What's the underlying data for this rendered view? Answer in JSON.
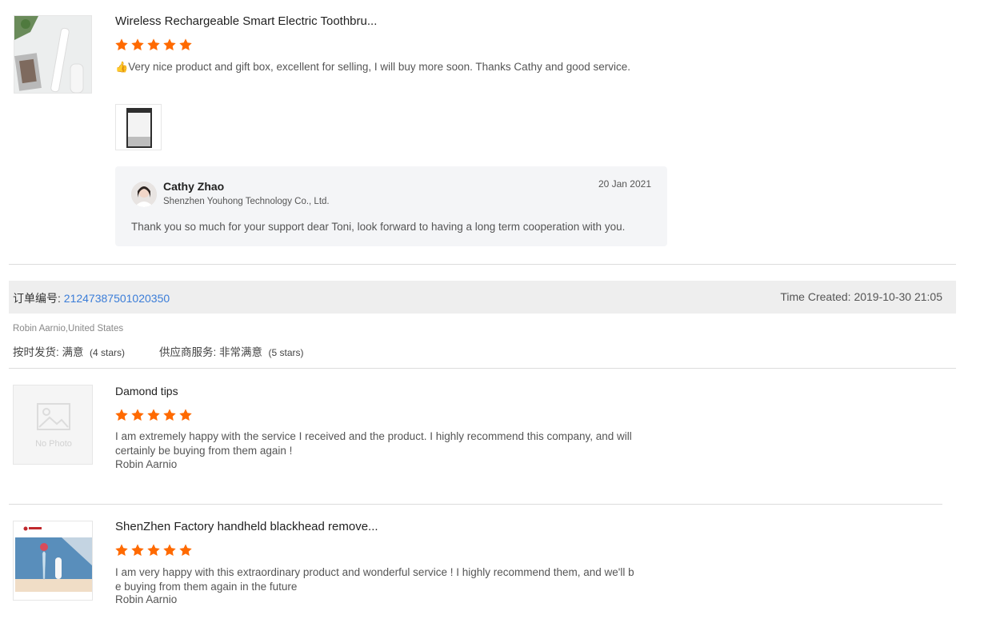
{
  "colors": {
    "star": "#ff6a00",
    "link": "#3b7dd8",
    "reply_bg": "#f4f5f7",
    "order_bar_bg": "#eeeeee"
  },
  "review1": {
    "product_title": "Wireless Rechargeable Smart Electric Toothbru...",
    "stars": 5,
    "thumbs_up_icon": "👍",
    "text": "Very nice product and gift box, excellent for selling, I will buy more soon. Thanks Cathy and good service.",
    "reply": {
      "name": "Cathy Zhao",
      "company": "Shenzhen Youhong Technology Co., Ltd.",
      "date": "20 Jan 2021",
      "text": "Thank you so much for your support dear Toni, look forward to having a long term cooperation with you."
    }
  },
  "order": {
    "label": "订单编号: ",
    "number": "21247387501020350",
    "time_label": "Time Created: ",
    "time": "2019-10-30 21:05",
    "buyer": "Robin Aarnio,United States",
    "shipping_label": "按时发货: ",
    "shipping_value": "满意",
    "shipping_stars": "(4 stars)",
    "service_label": "供应商服务: ",
    "service_value": "非常满意",
    "service_stars": "(5 stars)"
  },
  "review2": {
    "product_title": "Damond tips",
    "stars": 5,
    "no_photo_label": "No Photo",
    "text": "I am extremely happy with the service I received and the product. I highly recommend this company, and will certainly be buying from them again !",
    "author": "Robin Aarnio"
  },
  "review3": {
    "product_title": "ShenZhen Factory handheld blackhead remove...",
    "stars": 5,
    "text": "I am very happy with this extraordinary product and wonderful service ! I highly recommend them, and we'll be buying from them again in the future",
    "author": "Robin Aarnio"
  }
}
